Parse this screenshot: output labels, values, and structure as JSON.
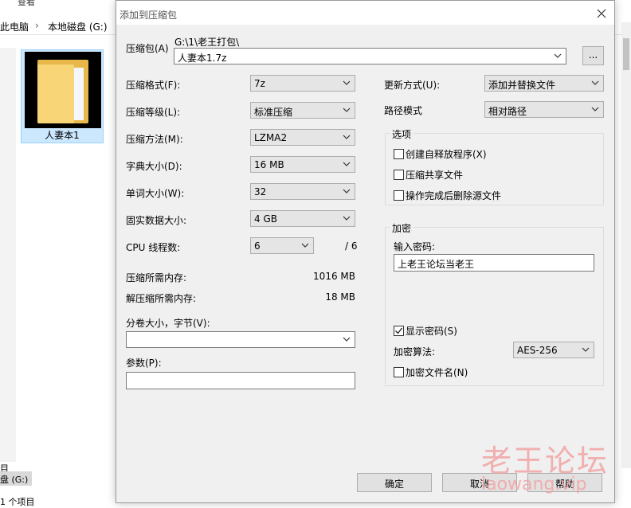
{
  "explorer": {
    "menu_text": "查看",
    "breadcrumb": [
      "此电脑",
      "本地磁盘 (G:)"
    ],
    "folder_name": "人妻本1",
    "bottom_rows": [
      "目",
      "盘 (G:)",
      "",
      "1 个项目"
    ]
  },
  "dialog": {
    "title": "添加到压缩包",
    "archive": {
      "label": "压缩包(A)",
      "path": "G:\\1\\老王打包\\",
      "name": "人妻本1.7z",
      "browse_label": "..."
    },
    "left": {
      "format_label": "压缩格式(F):",
      "format_value": "7z",
      "level_label": "压缩等级(L):",
      "level_value": "标准压缩",
      "method_label": "压缩方法(M):",
      "method_value": "LZMA2",
      "dict_label": "字典大小(D):",
      "dict_value": "16 MB",
      "word_label": "单词大小(W):",
      "word_value": "32",
      "solid_label": "固实数据大小:",
      "solid_value": "4 GB",
      "threads_label": "CPU 线程数:",
      "threads_value": "6",
      "threads_total": "/ 6",
      "mem_compress_label": "压缩所需内存:",
      "mem_compress_value": "1016 MB",
      "mem_decompress_label": "解压缩所需内存:",
      "mem_decompress_value": "18 MB",
      "split_label": "分卷大小，字节(V):",
      "split_value": "",
      "params_label": "参数(P):",
      "params_value": ""
    },
    "right": {
      "update_label": "更新方式(U):",
      "update_value": "添加并替换文件",
      "pathmode_label": "路径模式",
      "pathmode_value": "相对路径",
      "options_title": "选项",
      "opt_sfx": "创建自释放程序(X)",
      "opt_shared": "压缩共享文件",
      "opt_delete": "操作完成后删除源文件",
      "encrypt_title": "加密",
      "password_label": "输入密码:",
      "password_value": "上老王论坛当老王",
      "show_password": "显示密码(S)",
      "show_password_checked": true,
      "method_label": "加密算法:",
      "method_value": "AES-256",
      "encrypt_names": "加密文件名(N)"
    },
    "buttons": {
      "ok": "确定",
      "cancel": "取消",
      "help": "帮助"
    }
  },
  "watermark": {
    "cn": "老王论坛",
    "en": "laowang.vip",
    "color": "#f2a4a4"
  }
}
